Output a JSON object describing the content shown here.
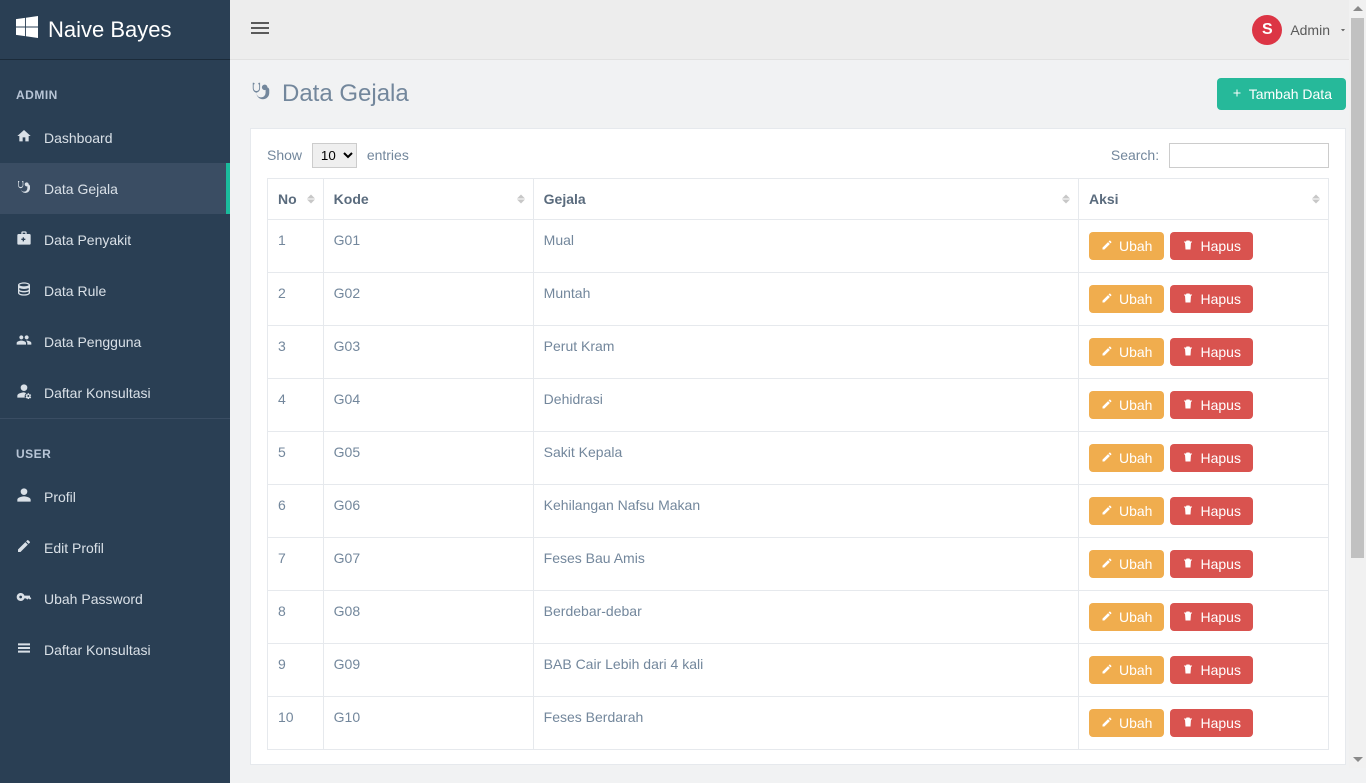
{
  "brand": "Naive Bayes",
  "topbar": {
    "user_label": "Admin",
    "avatar_initial": "S"
  },
  "sidebar": {
    "sections": [
      {
        "title": "ADMIN",
        "items": [
          {
            "label": "Dashboard",
            "icon": "home-icon",
            "name": "sidebar-item-dashboard",
            "active": false
          },
          {
            "label": "Data Gejala",
            "icon": "stethoscope-icon",
            "name": "sidebar-item-data-gejala",
            "active": true
          },
          {
            "label": "Data Penyakit",
            "icon": "medkit-icon",
            "name": "sidebar-item-data-penyakit",
            "active": false
          },
          {
            "label": "Data Rule",
            "icon": "database-icon",
            "name": "sidebar-item-data-rule",
            "active": false
          },
          {
            "label": "Data Pengguna",
            "icon": "users-icon",
            "name": "sidebar-item-data-pengguna",
            "active": false
          },
          {
            "label": "Daftar Konsultasi",
            "icon": "user-cog-icon",
            "name": "sidebar-item-daftar-konsultasi-admin",
            "active": false
          }
        ]
      },
      {
        "title": "USER",
        "items": [
          {
            "label": "Profil",
            "icon": "user-icon",
            "name": "sidebar-item-profil",
            "active": false
          },
          {
            "label": "Edit Profil",
            "icon": "pencil-icon",
            "name": "sidebar-item-edit-profil",
            "active": false
          },
          {
            "label": "Ubah Password",
            "icon": "key-icon",
            "name": "sidebar-item-ubah-password",
            "active": false
          },
          {
            "label": "Daftar Konsultasi",
            "icon": "list-icon",
            "name": "sidebar-item-daftar-konsultasi-user",
            "active": false
          }
        ]
      }
    ]
  },
  "page": {
    "title": "Data Gejala",
    "add_button": "Tambah Data"
  },
  "table": {
    "show_label": "Show",
    "entries_label": "entries",
    "entries_value": "10",
    "search_label": "Search:",
    "columns": [
      "No",
      "Kode",
      "Gejala",
      "Aksi"
    ],
    "ubah_label": "Ubah",
    "hapus_label": "Hapus",
    "rows": [
      {
        "no": "1",
        "kode": "G01",
        "gejala": "Mual"
      },
      {
        "no": "2",
        "kode": "G02",
        "gejala": "Muntah"
      },
      {
        "no": "3",
        "kode": "G03",
        "gejala": "Perut Kram"
      },
      {
        "no": "4",
        "kode": "G04",
        "gejala": "Dehidrasi"
      },
      {
        "no": "5",
        "kode": "G05",
        "gejala": "Sakit Kepala"
      },
      {
        "no": "6",
        "kode": "G06",
        "gejala": "Kehilangan Nafsu Makan"
      },
      {
        "no": "7",
        "kode": "G07",
        "gejala": "Feses Bau Amis"
      },
      {
        "no": "8",
        "kode": "G08",
        "gejala": "Berdebar-debar"
      },
      {
        "no": "9",
        "kode": "G09",
        "gejala": "BAB Cair Lebih dari 4 kali"
      },
      {
        "no": "10",
        "kode": "G10",
        "gejala": "Feses Berdarah"
      }
    ]
  }
}
